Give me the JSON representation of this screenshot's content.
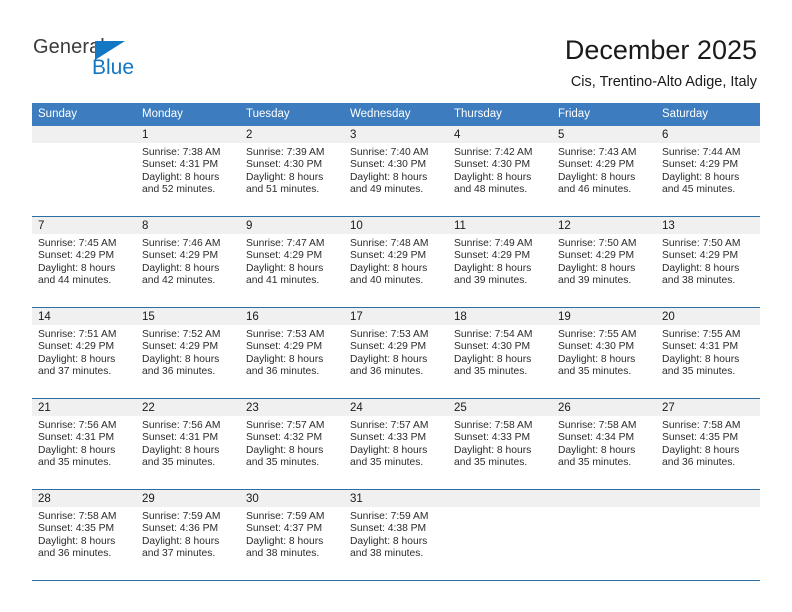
{
  "brand": {
    "name_part1": "General",
    "name_part2": "Blue",
    "accent_color": "#1477c4"
  },
  "header": {
    "title": "December 2025",
    "subtitle": "Cis, Trentino-Alto Adige, Italy"
  },
  "theme": {
    "header_blue": "#3c7cbf",
    "rule_blue": "#2e6da4",
    "daynum_band": "#f0f0f0"
  },
  "weekday_headers": [
    "Sunday",
    "Monday",
    "Tuesday",
    "Wednesday",
    "Thursday",
    "Friday",
    "Saturday"
  ],
  "weeks": [
    [
      {
        "day": "",
        "sunrise": "",
        "sunset": "",
        "daylight_line1": "",
        "daylight_line2": ""
      },
      {
        "day": "1",
        "sunrise": "Sunrise: 7:38 AM",
        "sunset": "Sunset: 4:31 PM",
        "daylight_line1": "Daylight: 8 hours",
        "daylight_line2": "and 52 minutes."
      },
      {
        "day": "2",
        "sunrise": "Sunrise: 7:39 AM",
        "sunset": "Sunset: 4:30 PM",
        "daylight_line1": "Daylight: 8 hours",
        "daylight_line2": "and 51 minutes."
      },
      {
        "day": "3",
        "sunrise": "Sunrise: 7:40 AM",
        "sunset": "Sunset: 4:30 PM",
        "daylight_line1": "Daylight: 8 hours",
        "daylight_line2": "and 49 minutes."
      },
      {
        "day": "4",
        "sunrise": "Sunrise: 7:42 AM",
        "sunset": "Sunset: 4:30 PM",
        "daylight_line1": "Daylight: 8 hours",
        "daylight_line2": "and 48 minutes."
      },
      {
        "day": "5",
        "sunrise": "Sunrise: 7:43 AM",
        "sunset": "Sunset: 4:29 PM",
        "daylight_line1": "Daylight: 8 hours",
        "daylight_line2": "and 46 minutes."
      },
      {
        "day": "6",
        "sunrise": "Sunrise: 7:44 AM",
        "sunset": "Sunset: 4:29 PM",
        "daylight_line1": "Daylight: 8 hours",
        "daylight_line2": "and 45 minutes."
      }
    ],
    [
      {
        "day": "7",
        "sunrise": "Sunrise: 7:45 AM",
        "sunset": "Sunset: 4:29 PM",
        "daylight_line1": "Daylight: 8 hours",
        "daylight_line2": "and 44 minutes."
      },
      {
        "day": "8",
        "sunrise": "Sunrise: 7:46 AM",
        "sunset": "Sunset: 4:29 PM",
        "daylight_line1": "Daylight: 8 hours",
        "daylight_line2": "and 42 minutes."
      },
      {
        "day": "9",
        "sunrise": "Sunrise: 7:47 AM",
        "sunset": "Sunset: 4:29 PM",
        "daylight_line1": "Daylight: 8 hours",
        "daylight_line2": "and 41 minutes."
      },
      {
        "day": "10",
        "sunrise": "Sunrise: 7:48 AM",
        "sunset": "Sunset: 4:29 PM",
        "daylight_line1": "Daylight: 8 hours",
        "daylight_line2": "and 40 minutes."
      },
      {
        "day": "11",
        "sunrise": "Sunrise: 7:49 AM",
        "sunset": "Sunset: 4:29 PM",
        "daylight_line1": "Daylight: 8 hours",
        "daylight_line2": "and 39 minutes."
      },
      {
        "day": "12",
        "sunrise": "Sunrise: 7:50 AM",
        "sunset": "Sunset: 4:29 PM",
        "daylight_line1": "Daylight: 8 hours",
        "daylight_line2": "and 39 minutes."
      },
      {
        "day": "13",
        "sunrise": "Sunrise: 7:50 AM",
        "sunset": "Sunset: 4:29 PM",
        "daylight_line1": "Daylight: 8 hours",
        "daylight_line2": "and 38 minutes."
      }
    ],
    [
      {
        "day": "14",
        "sunrise": "Sunrise: 7:51 AM",
        "sunset": "Sunset: 4:29 PM",
        "daylight_line1": "Daylight: 8 hours",
        "daylight_line2": "and 37 minutes."
      },
      {
        "day": "15",
        "sunrise": "Sunrise: 7:52 AM",
        "sunset": "Sunset: 4:29 PM",
        "daylight_line1": "Daylight: 8 hours",
        "daylight_line2": "and 36 minutes."
      },
      {
        "day": "16",
        "sunrise": "Sunrise: 7:53 AM",
        "sunset": "Sunset: 4:29 PM",
        "daylight_line1": "Daylight: 8 hours",
        "daylight_line2": "and 36 minutes."
      },
      {
        "day": "17",
        "sunrise": "Sunrise: 7:53 AM",
        "sunset": "Sunset: 4:29 PM",
        "daylight_line1": "Daylight: 8 hours",
        "daylight_line2": "and 36 minutes."
      },
      {
        "day": "18",
        "sunrise": "Sunrise: 7:54 AM",
        "sunset": "Sunset: 4:30 PM",
        "daylight_line1": "Daylight: 8 hours",
        "daylight_line2": "and 35 minutes."
      },
      {
        "day": "19",
        "sunrise": "Sunrise: 7:55 AM",
        "sunset": "Sunset: 4:30 PM",
        "daylight_line1": "Daylight: 8 hours",
        "daylight_line2": "and 35 minutes."
      },
      {
        "day": "20",
        "sunrise": "Sunrise: 7:55 AM",
        "sunset": "Sunset: 4:31 PM",
        "daylight_line1": "Daylight: 8 hours",
        "daylight_line2": "and 35 minutes."
      }
    ],
    [
      {
        "day": "21",
        "sunrise": "Sunrise: 7:56 AM",
        "sunset": "Sunset: 4:31 PM",
        "daylight_line1": "Daylight: 8 hours",
        "daylight_line2": "and 35 minutes."
      },
      {
        "day": "22",
        "sunrise": "Sunrise: 7:56 AM",
        "sunset": "Sunset: 4:31 PM",
        "daylight_line1": "Daylight: 8 hours",
        "daylight_line2": "and 35 minutes."
      },
      {
        "day": "23",
        "sunrise": "Sunrise: 7:57 AM",
        "sunset": "Sunset: 4:32 PM",
        "daylight_line1": "Daylight: 8 hours",
        "daylight_line2": "and 35 minutes."
      },
      {
        "day": "24",
        "sunrise": "Sunrise: 7:57 AM",
        "sunset": "Sunset: 4:33 PM",
        "daylight_line1": "Daylight: 8 hours",
        "daylight_line2": "and 35 minutes."
      },
      {
        "day": "25",
        "sunrise": "Sunrise: 7:58 AM",
        "sunset": "Sunset: 4:33 PM",
        "daylight_line1": "Daylight: 8 hours",
        "daylight_line2": "and 35 minutes."
      },
      {
        "day": "26",
        "sunrise": "Sunrise: 7:58 AM",
        "sunset": "Sunset: 4:34 PM",
        "daylight_line1": "Daylight: 8 hours",
        "daylight_line2": "and 35 minutes."
      },
      {
        "day": "27",
        "sunrise": "Sunrise: 7:58 AM",
        "sunset": "Sunset: 4:35 PM",
        "daylight_line1": "Daylight: 8 hours",
        "daylight_line2": "and 36 minutes."
      }
    ],
    [
      {
        "day": "28",
        "sunrise": "Sunrise: 7:58 AM",
        "sunset": "Sunset: 4:35 PM",
        "daylight_line1": "Daylight: 8 hours",
        "daylight_line2": "and 36 minutes."
      },
      {
        "day": "29",
        "sunrise": "Sunrise: 7:59 AM",
        "sunset": "Sunset: 4:36 PM",
        "daylight_line1": "Daylight: 8 hours",
        "daylight_line2": "and 37 minutes."
      },
      {
        "day": "30",
        "sunrise": "Sunrise: 7:59 AM",
        "sunset": "Sunset: 4:37 PM",
        "daylight_line1": "Daylight: 8 hours",
        "daylight_line2": "and 38 minutes."
      },
      {
        "day": "31",
        "sunrise": "Sunrise: 7:59 AM",
        "sunset": "Sunset: 4:38 PM",
        "daylight_line1": "Daylight: 8 hours",
        "daylight_line2": "and 38 minutes."
      },
      {
        "day": "",
        "sunrise": "",
        "sunset": "",
        "daylight_line1": "",
        "daylight_line2": ""
      },
      {
        "day": "",
        "sunrise": "",
        "sunset": "",
        "daylight_line1": "",
        "daylight_line2": ""
      },
      {
        "day": "",
        "sunrise": "",
        "sunset": "",
        "daylight_line1": "",
        "daylight_line2": ""
      }
    ]
  ]
}
